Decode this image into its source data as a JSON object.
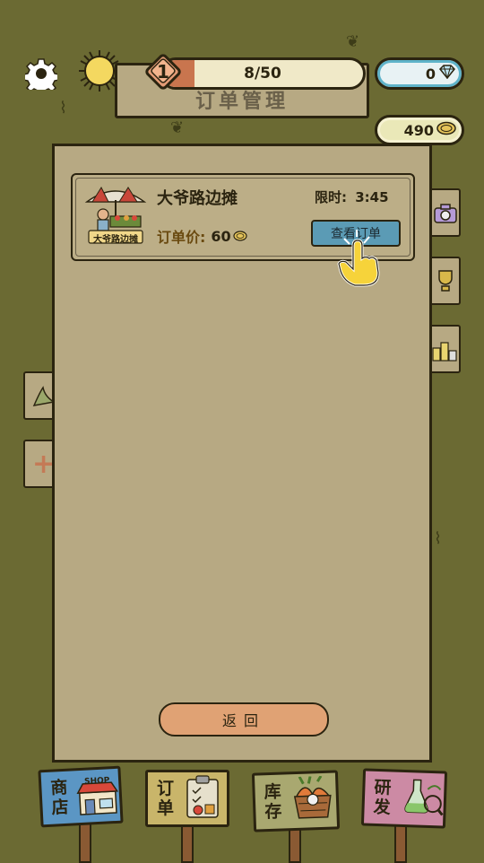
{
  "header": {
    "level": "1",
    "xp_text": "8/50",
    "xp_progress": 0.16,
    "diamonds": "0",
    "coins": "490",
    "sign_title": "订单管理"
  },
  "order": {
    "name": "大爷路边摊",
    "time_label": "限时:",
    "time_value": "3:45",
    "price_label": "订单价:",
    "price_value": "60",
    "view_button": "查看订单",
    "stall_sign_text": "大爷路边摊"
  },
  "back_button": "返回",
  "nav": {
    "shop": "商店",
    "shop_sign": "SHOP",
    "orders": "订单",
    "storage": "库存",
    "research": "研发"
  },
  "colors": {
    "background": "#6b6a33",
    "panel": "#b7a983",
    "view_button": "#5b9bb5",
    "back_button": "#e0a274",
    "diamond_pill": "#e8f2f4",
    "coin_pill": "#eae8b8"
  }
}
